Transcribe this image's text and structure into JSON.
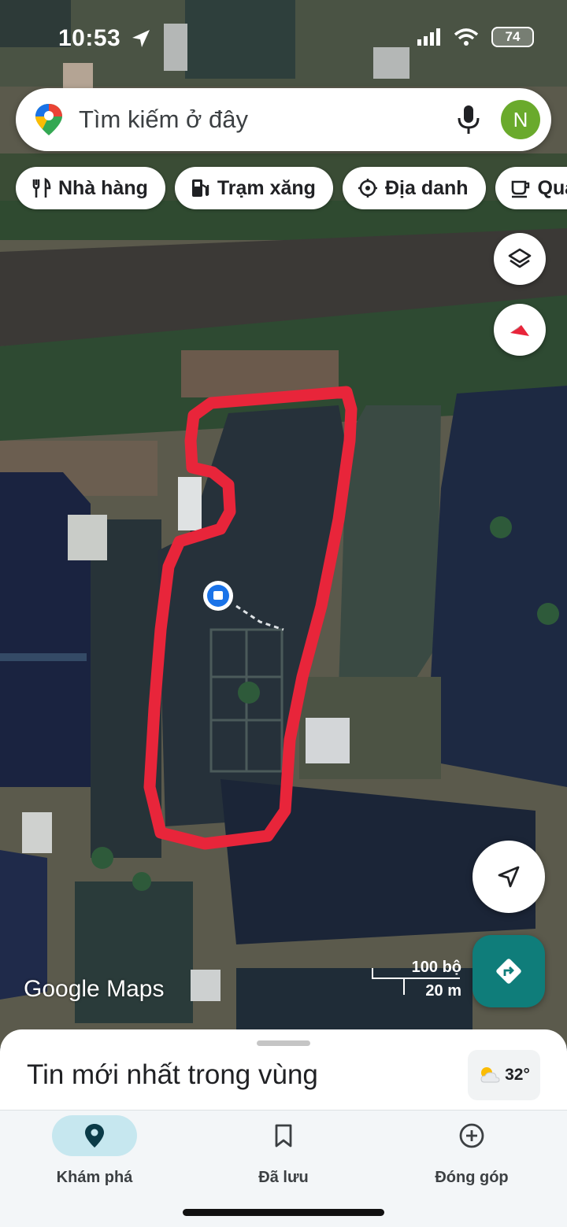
{
  "status_bar": {
    "time": "10:53",
    "battery": "74"
  },
  "search": {
    "placeholder": "Tìm kiếm ở đây",
    "avatar_initial": "N"
  },
  "chips": [
    {
      "label": "Nhà hàng",
      "icon": "restaurant-icon"
    },
    {
      "label": "Trạm xăng",
      "icon": "gas-station-icon"
    },
    {
      "label": "Địa danh",
      "icon": "landmark-icon"
    },
    {
      "label": "Quán",
      "icon": "coffee-icon"
    }
  ],
  "map": {
    "scale_top": "100 bộ",
    "scale_bottom": "20 m",
    "watermark_google": "Google",
    "watermark_maps": "Maps",
    "outline_color": "#e8253a"
  },
  "sheet": {
    "title": "Tin mới nhất trong vùng",
    "temperature": "32°"
  },
  "nav": [
    {
      "label": "Khám phá",
      "icon": "explore-pin-icon",
      "active": true
    },
    {
      "label": "Đã lưu",
      "icon": "bookmark-icon",
      "active": false
    },
    {
      "label": "Đóng góp",
      "icon": "add-circle-icon",
      "active": false
    }
  ],
  "colors": {
    "accent": "#0f7d7a",
    "active_pill": "#c6e7ef"
  }
}
